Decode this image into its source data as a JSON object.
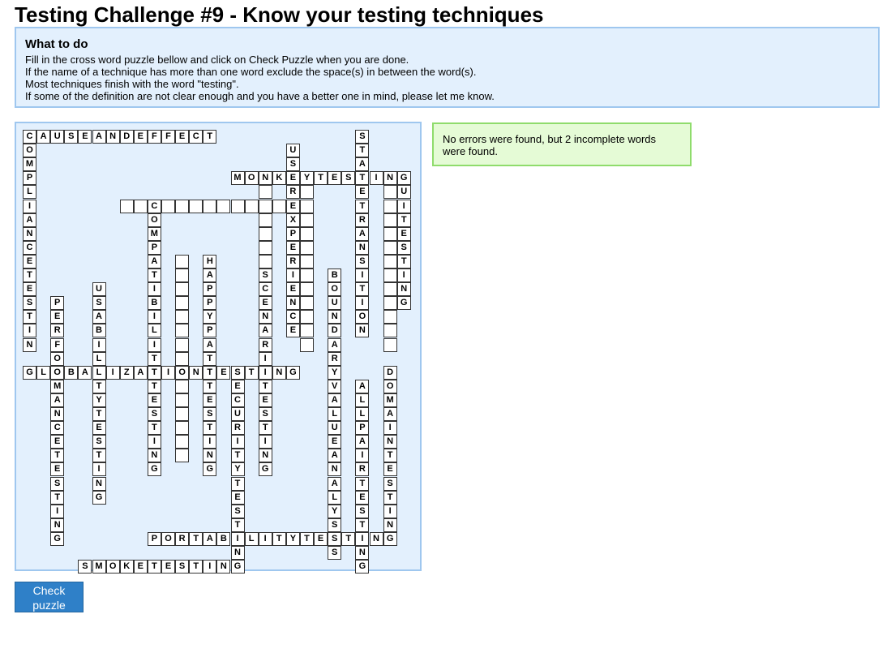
{
  "page": {
    "title": "Testing Challenge #9 - Know your testing techniques"
  },
  "instructions": {
    "heading": "What to do",
    "lines": [
      "Fill in the cross word puzzle bellow and click on Check Puzzle when you are done.",
      "If the name of a technique has more than one word exclude the space(s) in between the word(s).",
      "Most techniques finish with the word \"testing\".",
      "If some of the definition are not clear enough and you have a better one in mind, please let me know."
    ]
  },
  "result": {
    "message": "No errors were found, but 2 incomplete words were found."
  },
  "check_button": {
    "label": "Check puzzle"
  },
  "puzzle": {
    "words": [
      {
        "dir": "across",
        "row": 0,
        "col": 0,
        "text": "CAUSEANDEFFECT"
      },
      {
        "dir": "across",
        "row": 3,
        "col": 15,
        "text": "MONKEYTESTING"
      },
      {
        "dir": "across",
        "row": 5,
        "col": 7,
        "text": "             "
      },
      {
        "dir": "across",
        "row": 17,
        "col": 0,
        "text": "GLOBALIZATIONTESTING"
      },
      {
        "dir": "across",
        "row": 29,
        "col": 9,
        "text": "PORTABILITYTESTING"
      },
      {
        "dir": "across",
        "row": 31,
        "col": 4,
        "text": "SMOKETESTING"
      },
      {
        "dir": "down",
        "row": 0,
        "col": 0,
        "text": "COMPLIANCETESTIN"
      },
      {
        "dir": "down",
        "row": 0,
        "col": 24,
        "text": "STATETRANSITION"
      },
      {
        "dir": "down",
        "row": 1,
        "col": 19,
        "text": "USEREXPERIENCE"
      },
      {
        "dir": "down",
        "row": 3,
        "col": 27,
        "text": "GUITESTING"
      },
      {
        "dir": "down",
        "row": 3,
        "col": 17,
        "text": "             "
      },
      {
        "dir": "down",
        "row": 3,
        "col": 20,
        "text": "             "
      },
      {
        "dir": "down",
        "row": 3,
        "col": 26,
        "text": "             "
      },
      {
        "dir": "down",
        "row": 5,
        "col": 9,
        "text": "COMPATIBILITYTESTING"
      },
      {
        "dir": "down",
        "row": 9,
        "col": 11,
        "text": "               "
      },
      {
        "dir": "down",
        "row": 9,
        "col": 13,
        "text": "HAPPYPATHTESTING"
      },
      {
        "dir": "down",
        "row": 10,
        "col": 17,
        "text": "SCENARIOTESTING"
      },
      {
        "dir": "down",
        "row": 10,
        "col": 22,
        "text": "BOUNDARYVALUEANALYSIS"
      },
      {
        "dir": "down",
        "row": 11,
        "col": 5,
        "text": "USABILITYTESTING"
      },
      {
        "dir": "down",
        "row": 12,
        "col": 2,
        "text": "PERFORMANCETESTING"
      },
      {
        "dir": "down",
        "row": 17,
        "col": 15,
        "text": "SECURITYTESTING"
      },
      {
        "dir": "down",
        "row": 17,
        "col": 26,
        "text": "DOMAINTESTING"
      },
      {
        "dir": "down",
        "row": 18,
        "col": 24,
        "text": "ALLPAIRTESTING"
      }
    ]
  }
}
